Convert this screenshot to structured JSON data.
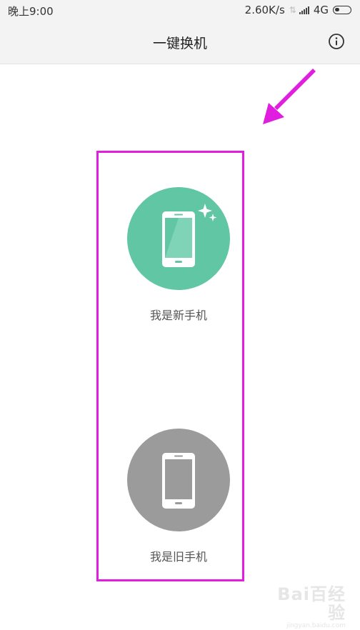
{
  "status_bar": {
    "time": "晚上9:00",
    "speed": "2.60K/s",
    "network": "4G",
    "icons": [
      "data-arrows-icon",
      "signal-icon",
      "battery-icon"
    ]
  },
  "header": {
    "title": "一键换机",
    "info_icon": "info-circle-icon"
  },
  "options": [
    {
      "label": "我是新手机",
      "icon": "phone-sparkle-icon",
      "color": "#60c6a3"
    },
    {
      "label": "我是旧手机",
      "icon": "phone-icon",
      "color": "#9b9b9b"
    }
  ],
  "annotation": {
    "color": "#e01ee0"
  },
  "watermark": {
    "logo": "Bai百经验",
    "url": "jingyan.baidu.com"
  }
}
